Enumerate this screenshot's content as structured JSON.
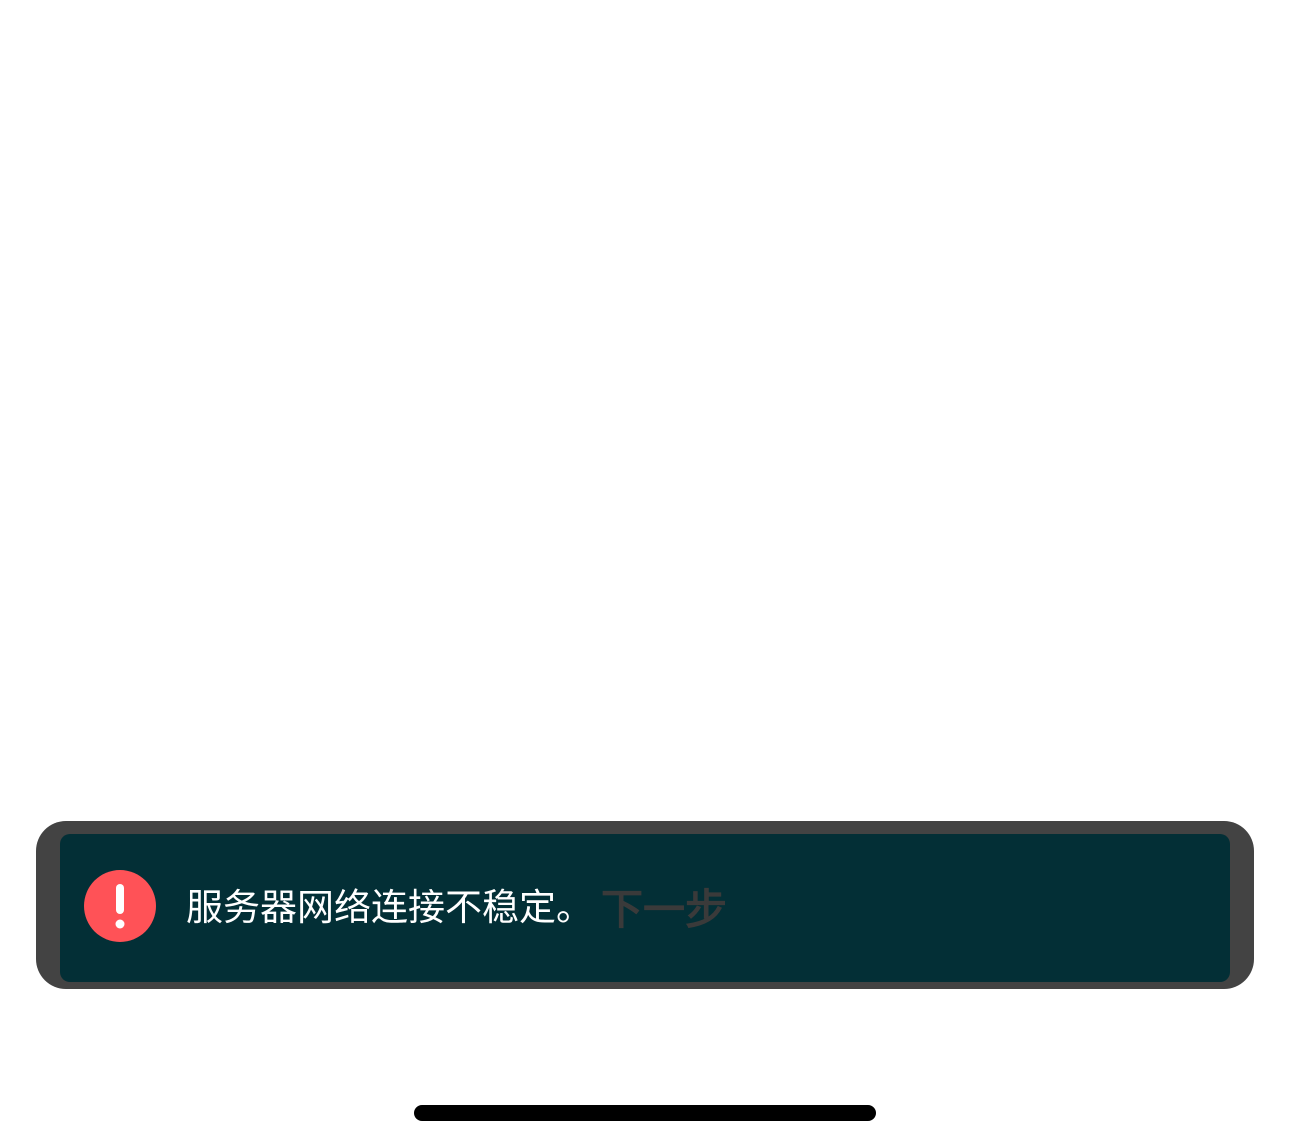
{
  "toast": {
    "icon": "alert-circle-icon",
    "icon_color": "#ff5257",
    "message": "服务器网络连接不稳定。",
    "background": "#032f36",
    "frame_color": "#434343"
  },
  "footer": {
    "next_label": "下一步"
  }
}
